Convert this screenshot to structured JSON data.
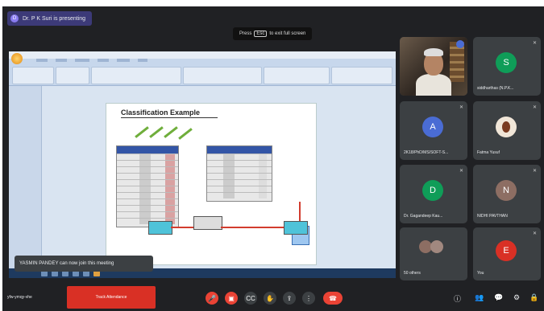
{
  "presenting": {
    "label": "Dr. P K Suri is presenting",
    "initial": "D"
  },
  "fullscreen_hint": {
    "prefix": "Press",
    "key": "Esc",
    "suffix": "to exit full screen"
  },
  "slide": {
    "title": "Classification Example"
  },
  "toast": {
    "text": "YASMIN PANDEY can now join this meeting"
  },
  "participants": [
    {
      "name": "",
      "initial": "",
      "color": "#3c4043",
      "presenter": true
    },
    {
      "name": "siddharthas (N.P.K...",
      "initial": "S",
      "color": "#0f9d58"
    },
    {
      "name": "2K18/PhD/MS/SOFT-S...",
      "initial": "A",
      "color": "#4a6cd4"
    },
    {
      "name": "Fatma Yusuf",
      "initial": "",
      "color": "#3c4043"
    },
    {
      "name": "Dr. Gagandeep Kau...",
      "initial": "D",
      "color": "#0f9d58"
    },
    {
      "name": "NIDHI PAVTHAN",
      "initial": "N",
      "color": "#8d6e63"
    },
    {
      "name": "50 others",
      "initial": "",
      "color": "#5f6368"
    },
    {
      "name": "You",
      "initial": "E",
      "color": "#d93025"
    }
  ],
  "bottom": {
    "meeting_code": "yfw-ymqy-vhe",
    "banner": "Track Attendance"
  },
  "icons": {
    "mic": "mic-off-icon",
    "cam": "camera-off-icon",
    "cc": "captions-icon",
    "hand": "raise-hand-icon",
    "present": "present-icon",
    "more": "more-icon",
    "end": "end-call-icon"
  }
}
